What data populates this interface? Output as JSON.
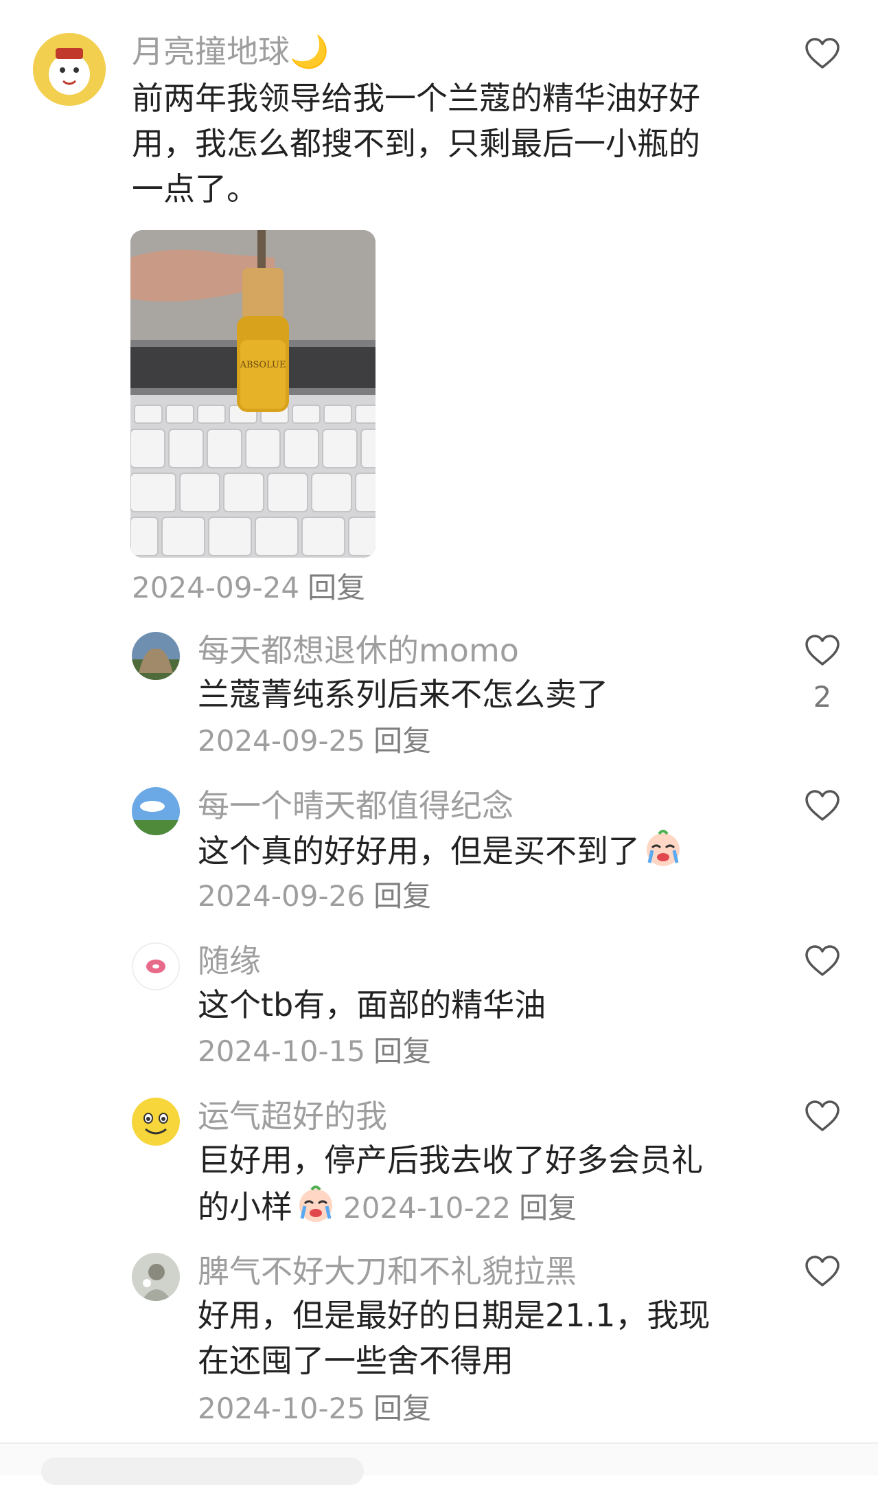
{
  "main_comment": {
    "author": "月亮撞地球🌙",
    "text_lines": [
      "前两年我领导给我一个兰蔻的精华油好好",
      "用，我怎么都搜不到，只剩最后一小瓶的",
      "一点了。"
    ],
    "date": "2024-09-24",
    "reply_label": "回复",
    "photo_label": "ABSOLUE"
  },
  "replies": [
    {
      "author": "每天都想退休的momo",
      "text": "兰蔻菁纯系列后来不怎么卖了",
      "date": "2024-09-25",
      "reply_label": "回复",
      "like_count": "2"
    },
    {
      "author": "每一个晴天都值得纪念",
      "text": "这个真的好好用，但是买不到了",
      "date": "2024-09-26",
      "reply_label": "回复"
    },
    {
      "author": "随缘",
      "text": "这个tb有，面部的精华油",
      "date": "2024-10-15",
      "reply_label": "回复"
    },
    {
      "author": "运气超好的我",
      "text_line1": "巨好用，停产后我去收了好多会员礼",
      "text_line2": "的小样",
      "date": "2024-10-22",
      "reply_label": "回复"
    },
    {
      "author": "脾气不好大刀和不礼貌拉黑",
      "text_line1": "好用，但是最好的日期是21.1，我现",
      "text_line2": "在还囤了一些舍不得用",
      "date": "2024-10-25",
      "reply_label": "回复"
    }
  ],
  "icons": {
    "like": "heart-outline-icon",
    "emoji": "crying-face-emoji"
  },
  "colors": {
    "secondary_text": "#9e9e9e",
    "primary_text": "#222222",
    "accent_avatar": "#f2cf4e"
  }
}
